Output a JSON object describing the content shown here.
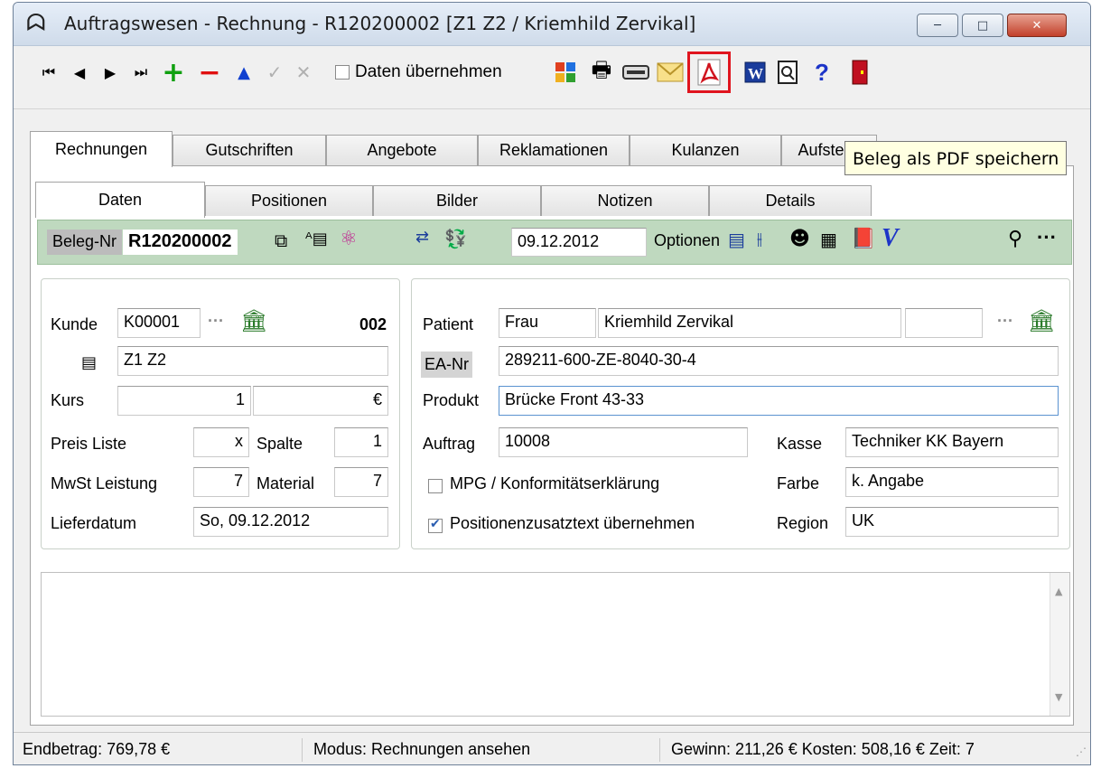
{
  "window": {
    "title": "Auftragswesen - Rechnung - R120200002 [Z1 Z2 / Kriemhild Zervikal]",
    "app_icon": "tooth-icon",
    "controls": {
      "minimize": "─",
      "maximize": "□",
      "close": "✕"
    }
  },
  "toolbar": {
    "first": "⏮",
    "prev": "◀",
    "next": "▶",
    "last": "⏭",
    "add": "+",
    "remove": "−",
    "up": "▲",
    "confirm": "✓",
    "cancel": "✕",
    "daten_uebernehmen": "Daten übernehmen",
    "help": "?"
  },
  "tooltip": "Beleg als PDF speichern",
  "tabs": [
    "Rechnungen",
    "Gutschriften",
    "Angebote",
    "Reklamationen",
    "Kulanzen",
    "Aufstellu"
  ],
  "subtabs": [
    "Daten",
    "Positionen",
    "Bilder",
    "Notizen",
    "Details"
  ],
  "belegbar": {
    "label": "Beleg-Nr",
    "number": "R120200002",
    "date": "09.12.2012",
    "optionen": "Optionen"
  },
  "left": {
    "kunde_label": "Kunde",
    "kunde": "K00001",
    "dots": "···",
    "kunde_nr": "002",
    "zz": "Z1 Z2",
    "kurs_label": "Kurs",
    "kurs": "1",
    "currency": "€",
    "preisliste_label": "Preis Liste",
    "preisliste": "x",
    "spalte_label": "Spalte",
    "spalte": "1",
    "mwst_label": "MwSt Leistung",
    "mwst": "7",
    "material_label": "Material",
    "material": "7",
    "lieferdatum_label": "Lieferdatum",
    "lieferdatum": "So, 09.12.2012"
  },
  "right": {
    "patient_label": "Patient",
    "anrede": "Frau",
    "name": "Kriemhild Zervikal",
    "extra": "",
    "dots": "···",
    "ea_label": "EA-Nr",
    "ea": "289211-600-ZE-8040-30-4",
    "produkt_label": "Produkt",
    "produkt": "Brücke Front 43-33",
    "auftrag_label": "Auftrag",
    "auftrag": "10008",
    "kasse_label": "Kasse",
    "kasse": "Techniker KK Bayern",
    "mpg_label": "MPG / Konformitätserklärung",
    "mpg_checked": false,
    "farbe_label": "Farbe",
    "farbe": "k. Angabe",
    "pos_label": "Positionenzusatztext übernehmen",
    "pos_checked": true,
    "region_label": "Region",
    "region": "UK"
  },
  "status": {
    "endbetrag": "Endbetrag: 769,78 €",
    "modus": "Modus:  Rechnungen ansehen",
    "gewinn": "Gewinn: 211,26 €  Kosten: 508,16 €  Zeit: 7"
  },
  "colors": {
    "accent_green": "#bfd9bf",
    "highlight_red": "#e0141e"
  }
}
